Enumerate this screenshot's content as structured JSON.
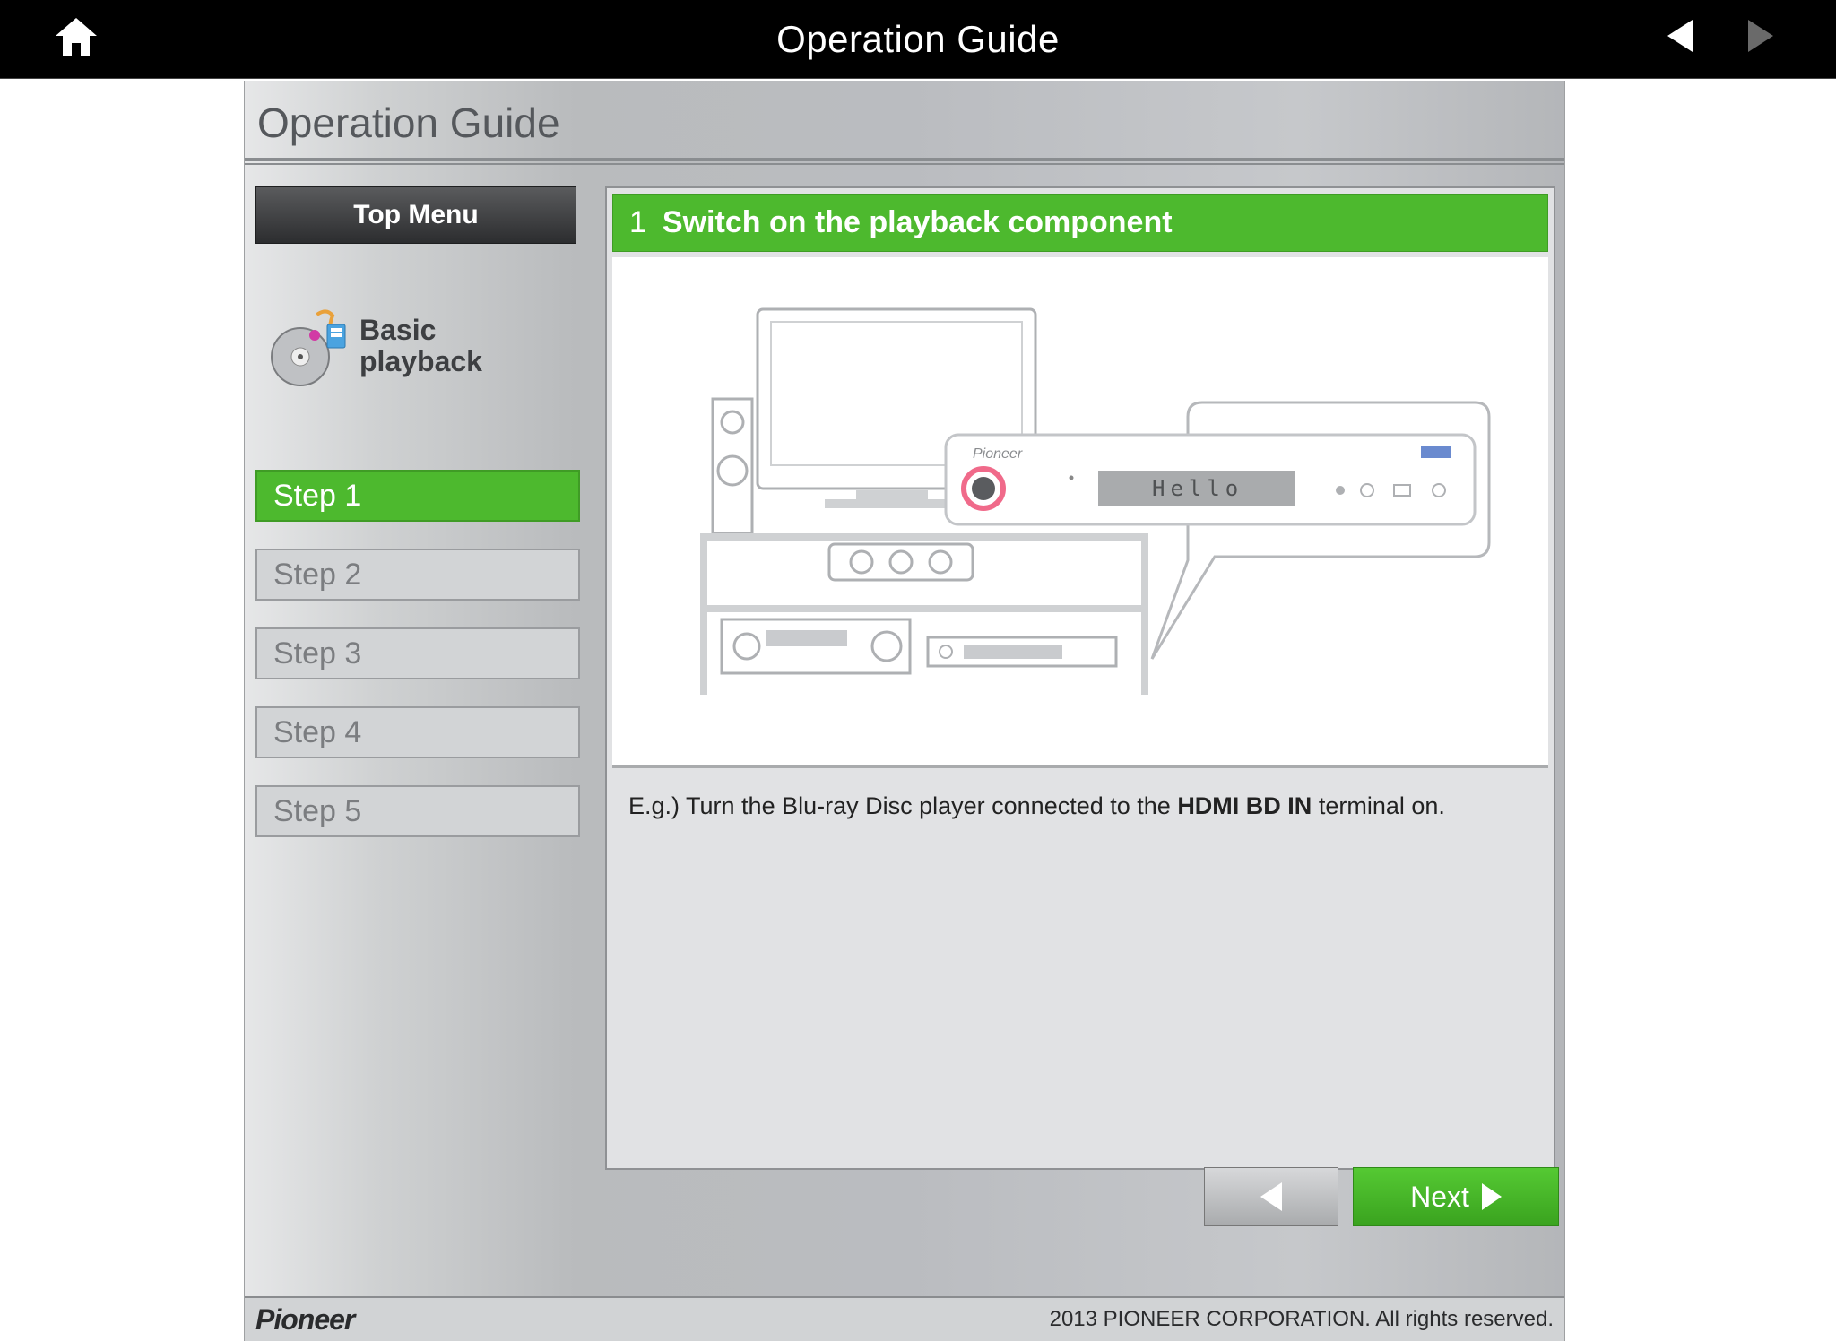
{
  "topbar": {
    "title": "Operation Guide"
  },
  "page": {
    "title": "Operation Guide"
  },
  "sidebar": {
    "top_menu": "Top Menu",
    "topic": "Basic playback",
    "steps": [
      {
        "label": "Step 1",
        "active": true
      },
      {
        "label": "Step 2",
        "active": false
      },
      {
        "label": "Step 3",
        "active": false
      },
      {
        "label": "Step 4",
        "active": false
      },
      {
        "label": "Step 5",
        "active": false
      }
    ]
  },
  "content": {
    "step_number": "1",
    "step_title": "Switch on the playback component",
    "illustration": {
      "device_display_text": "Hello",
      "device_brand": "Pioneer"
    },
    "description_prefix": "E.g.) Turn the Blu-ray Disc player connected to the ",
    "description_bold": "HDMI BD IN",
    "description_suffix": " terminal on."
  },
  "pager": {
    "next": "Next"
  },
  "footer": {
    "brand": "Pioneer",
    "copyright": "2013 PIONEER CORPORATION. All rights reserved."
  }
}
